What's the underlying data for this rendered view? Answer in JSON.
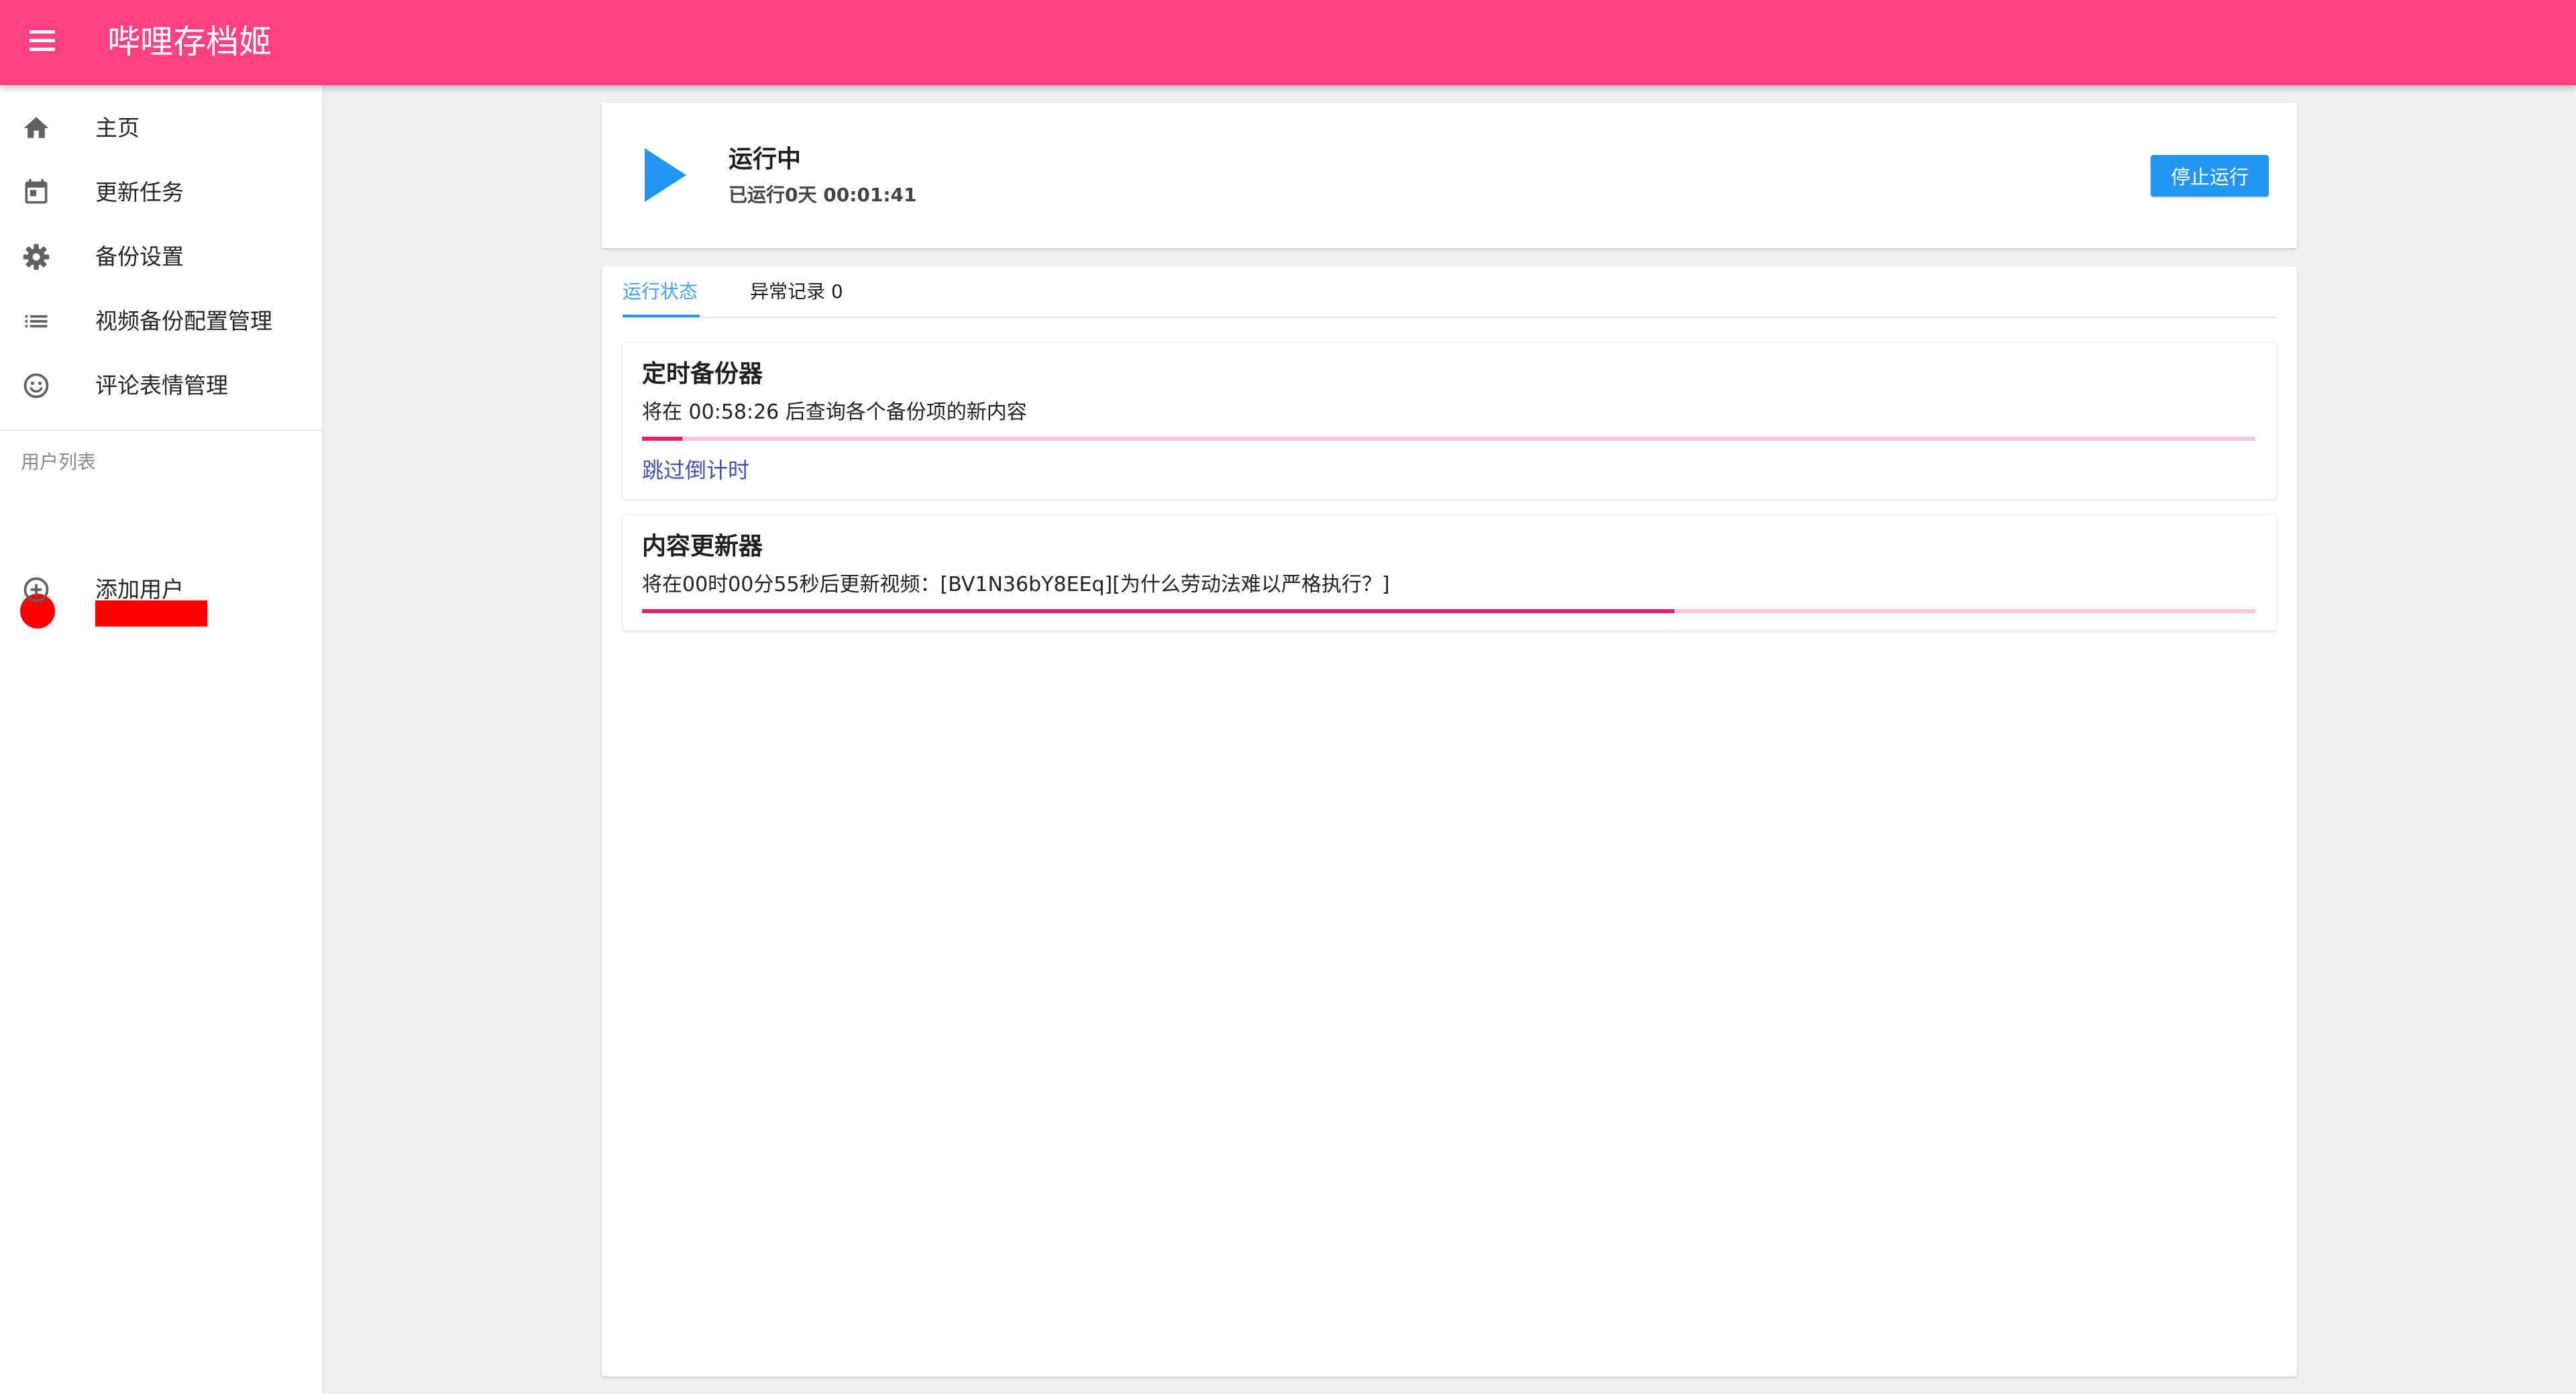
{
  "app": {
    "title": "哔哩存档姬"
  },
  "sidebar": {
    "items": [
      {
        "label": "主页",
        "icon": "home-icon"
      },
      {
        "label": "更新任务",
        "icon": "calendar-icon"
      },
      {
        "label": "备份设置",
        "icon": "gear-icon"
      },
      {
        "label": "视频备份配置管理",
        "icon": "list-icon"
      },
      {
        "label": "评论表情管理",
        "icon": "smile-icon"
      }
    ],
    "subheader": "用户列表",
    "add_user": {
      "label": "添加用户",
      "icon": "add-circle-icon"
    }
  },
  "status": {
    "title": "运行中",
    "uptime": "已运行0天 00:01:41",
    "stop_button": "停止运行"
  },
  "tabs": [
    {
      "label": "运行状态",
      "active": true
    },
    {
      "label": "异常记录 0",
      "active": false
    }
  ],
  "tasks": [
    {
      "title": "定时备份器",
      "text": "将在 00:58:26 后查询各个备份项的新内容",
      "progress": 0.025,
      "link": "跳过倒计时"
    },
    {
      "title": "内容更新器",
      "text": "将在00时00分55秒后更新视频：[BV1N36bY8EEq][为什么劳动法难以严格执行？]",
      "progress": 0.64
    }
  ],
  "colors": {
    "appbar": "#ff4081",
    "primary": "#2196f3",
    "progress": "#e91e63",
    "progress_track": "#f8c6d8",
    "redaction": "#ff0000"
  }
}
